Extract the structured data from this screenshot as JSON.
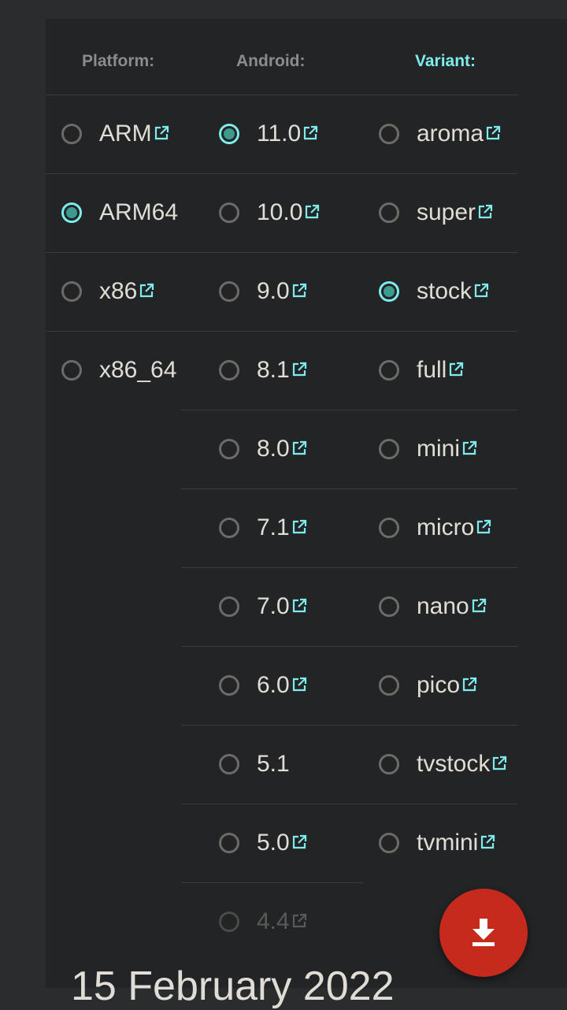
{
  "headers": {
    "platform": "Platform:",
    "android": "Android:",
    "variant": "Variant:"
  },
  "platforms": [
    {
      "label": "ARM",
      "link": true,
      "checked": false
    },
    {
      "label": "ARM64",
      "link": false,
      "checked": true
    },
    {
      "label": "x86",
      "link": true,
      "checked": false
    },
    {
      "label": "x86_64",
      "link": false,
      "checked": false
    }
  ],
  "android_versions": [
    {
      "label": "11.0",
      "link": true,
      "checked": true
    },
    {
      "label": "10.0",
      "link": true,
      "checked": false
    },
    {
      "label": "9.0",
      "link": true,
      "checked": false
    },
    {
      "label": "8.1",
      "link": true,
      "checked": false
    },
    {
      "label": "8.0",
      "link": true,
      "checked": false
    },
    {
      "label": "7.1",
      "link": true,
      "checked": false
    },
    {
      "label": "7.0",
      "link": true,
      "checked": false
    },
    {
      "label": "6.0",
      "link": true,
      "checked": false
    },
    {
      "label": "5.1",
      "link": false,
      "checked": false
    },
    {
      "label": "5.0",
      "link": true,
      "checked": false
    },
    {
      "label": "4.4",
      "link": true,
      "checked": false,
      "disabled": true
    }
  ],
  "variants": [
    {
      "label": "aroma",
      "link": true,
      "checked": false
    },
    {
      "label": "super",
      "link": true,
      "checked": false
    },
    {
      "label": "stock",
      "link": true,
      "checked": true
    },
    {
      "label": "full",
      "link": true,
      "checked": false
    },
    {
      "label": "mini",
      "link": true,
      "checked": false
    },
    {
      "label": "micro",
      "link": true,
      "checked": false
    },
    {
      "label": "nano",
      "link": true,
      "checked": false
    },
    {
      "label": "pico",
      "link": true,
      "checked": false
    },
    {
      "label": "tvstock",
      "link": true,
      "checked": false
    },
    {
      "label": "tvmini",
      "link": true,
      "checked": false
    }
  ],
  "download_icon": "download-icon",
  "external_link_icon": "external-link-icon",
  "date_text": "15 February 2022",
  "colors": {
    "accent": "#7eecec",
    "fab": "#c62a1d"
  }
}
